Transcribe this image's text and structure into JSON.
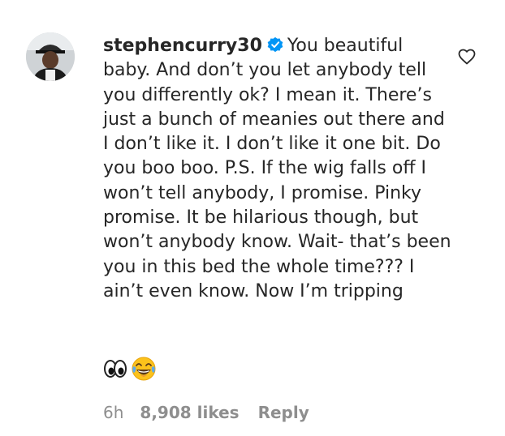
{
  "comment": {
    "username": "stephencurry30",
    "verified": true,
    "text": "You beautiful baby. And don’t you let anybody tell you differently ok? I mean it. There’s just a bunch of meanies out there and I don’t like it. I don’t like it one bit. Do you boo boo. P.S. If the wig falls off I won’t tell anybody, I promise. Pinky promise. It be hilarious though, but won’t anybody know. Wait- that’s been you in this bed the whole time??? I ain’t even know. Now I’m tripping",
    "emojis": [
      "eyes-emoji",
      "face-with-tears-of-joy-emoji"
    ],
    "time": "6h",
    "likes": "8,908 likes",
    "reply_label": "Reply"
  },
  "icons": {
    "verified": "verified-badge-icon",
    "like": "heart-outline-icon"
  },
  "colors": {
    "text": "#262626",
    "meta": "#8e8e8e",
    "verified_badge": "#0095f6"
  }
}
